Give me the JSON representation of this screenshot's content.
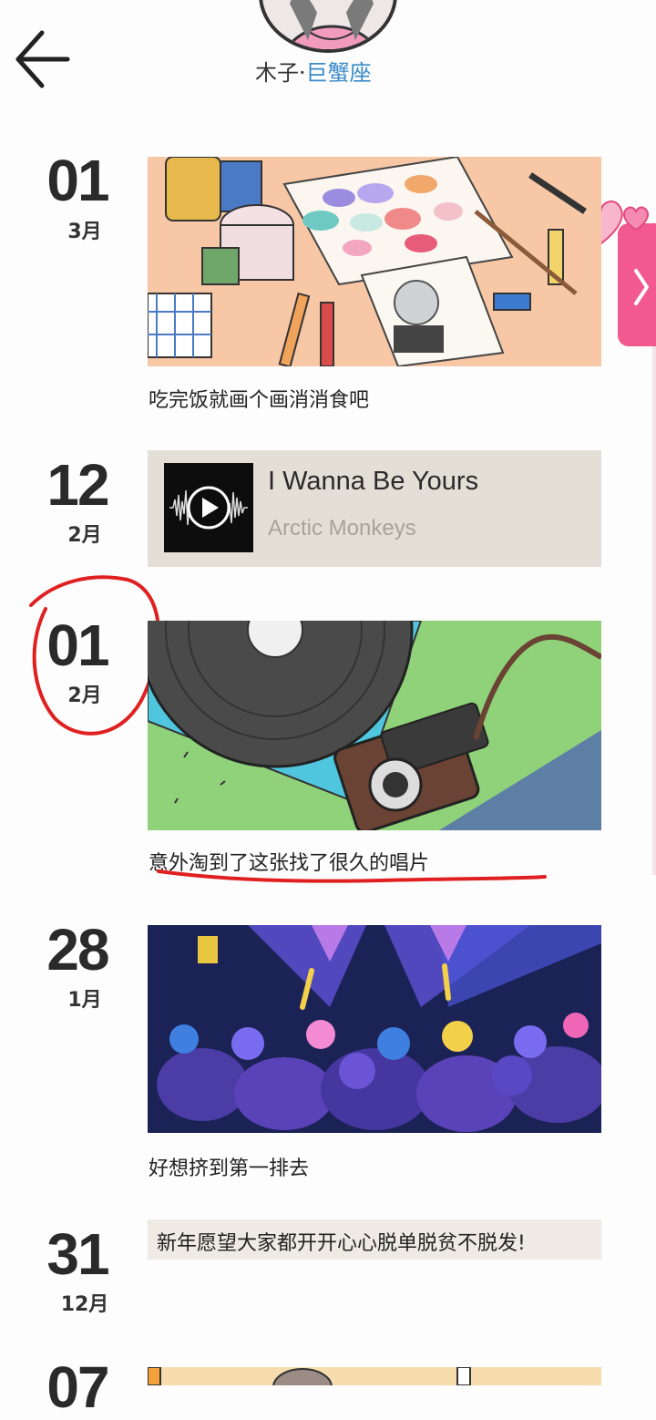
{
  "header": {
    "back_icon": "arrow-left-icon",
    "avatar": "avatar-image",
    "name_part1": "木子·",
    "name_part2": "巨蟹座"
  },
  "posts": [
    {
      "day": "01",
      "month": "3月",
      "type": "image",
      "image": "painting-supplies-illustration",
      "caption": "吃完饭就画个画消消食吧"
    },
    {
      "day": "12",
      "month": "2月",
      "type": "music",
      "song": "I Wanna Be Yours",
      "artist": "Arctic Monkeys",
      "cover_icon": "play-icon"
    },
    {
      "day": "01",
      "month": "2月",
      "type": "image",
      "image": "vinyl-record-and-camera-illustration",
      "caption": "意外淘到了这张找了很久的唱片"
    },
    {
      "day": "28",
      "month": "1月",
      "type": "image",
      "image": "concert-crowd-illustration",
      "caption": "好想挤到第一排去"
    },
    {
      "day": "31",
      "month": "12月",
      "type": "text",
      "text": "新年愿望大家都开开心心脱单脱贫不脱发!"
    },
    {
      "day": "07",
      "month": "",
      "type": "image",
      "image": "partial-illustration"
    }
  ],
  "side_tab": {
    "icon": "chevron-right-icon",
    "decor": "hearts-icon"
  },
  "annotations": {
    "circle_color": "#e02020",
    "underline_color": "#e02020"
  },
  "colors": {
    "accent_pink": "#f25a8f",
    "name_blue": "#3a8bc9"
  }
}
